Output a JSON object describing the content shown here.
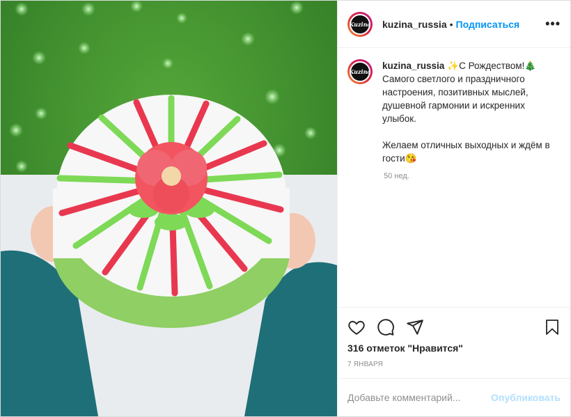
{
  "post": {
    "username": "kuzina_russia",
    "separator": "•",
    "follow_label": "Подписаться",
    "more_label": "•••",
    "avatar_text": "Kuzina",
    "caption_line1": "✨С Рождеством!🎄",
    "caption_rest": "Самого светлого и праздничного настроения, позитивных мыслей, душевной гармонии и искренних улыбок.\n\nЖелаем отличных выходных и ждём в гости😘",
    "caption_time": "50 нед.",
    "likes_text": "316 отметок \"Нравится\"",
    "date_text": "7 ЯНВАРЯ",
    "comment_placeholder": "Добавьте комментарий...",
    "publish_label": "Опубликовать"
  },
  "icons": {
    "like": "heart-icon",
    "comment": "speech-bubble-icon",
    "share": "paper-plane-icon",
    "save": "bookmark-icon",
    "more": "ellipsis-icon"
  },
  "colors": {
    "accent": "#0095f6",
    "publish_disabled": "#b2dffc",
    "muted": "#8e8e8e",
    "image_background": "#3c8a2c",
    "cake_red": "#e8384f",
    "cake_green": "#7ed957",
    "sleeve": "#1f6f78"
  }
}
